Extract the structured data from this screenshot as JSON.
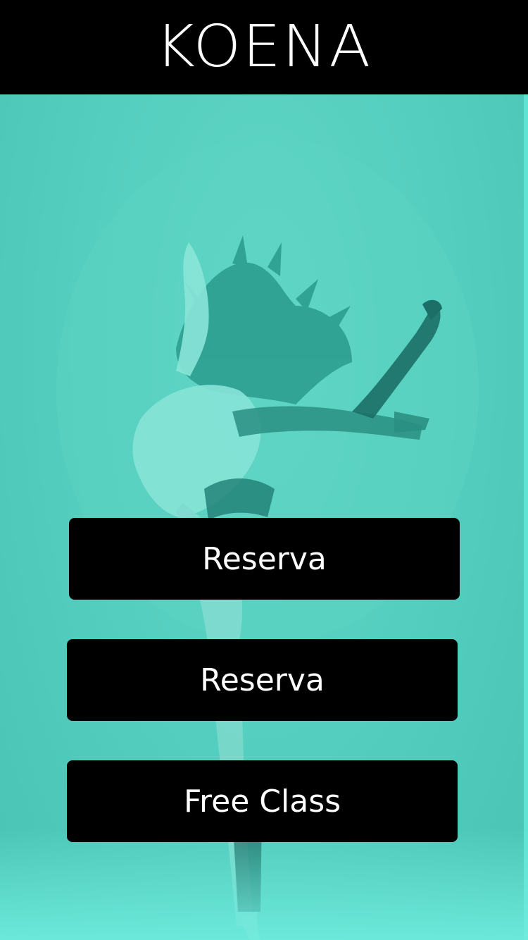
{
  "header": {
    "brand": "KOENA"
  },
  "hero": {
    "image_alt": "dancer-photo"
  },
  "buttons": [
    {
      "label": "Reserva"
    },
    {
      "label": "Reserva"
    },
    {
      "label": "Free Class"
    }
  ],
  "colors": {
    "header_bg": "#000000",
    "hero_tint": "#55cfbf",
    "button_bg": "#000000",
    "button_text": "#ffffff"
  }
}
